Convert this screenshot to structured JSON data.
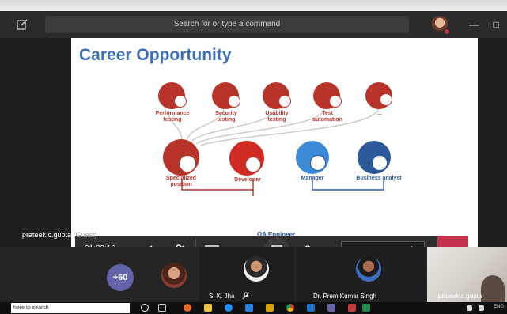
{
  "titlebar": {
    "search_placeholder": "Search for or type a command",
    "window_controls": [
      "—",
      "□"
    ]
  },
  "slide": {
    "title": "Career Opportunity",
    "top_nodes": [
      {
        "label": "Performance\ntesting",
        "icon": "stopwatch-icon"
      },
      {
        "label": "Security\ntesting",
        "icon": "lock-icon"
      },
      {
        "label": "Usability\ntesting",
        "icon": "thumbs-up-icon"
      },
      {
        "label": "Test\nautomation",
        "icon": "gear-icon"
      },
      {
        "label": "...",
        "icon": "magnifier-icon"
      }
    ],
    "bottom_nodes": [
      {
        "label": "Specialized\nposition",
        "icon": "cog-icon",
        "color": "#b8332a"
      },
      {
        "label": "Developer",
        "icon": "laptop-icon",
        "color": "#b8332a"
      },
      {
        "label": "Manager",
        "icon": "briefcase-icon",
        "color": "#2d5a9a"
      },
      {
        "label": "Business analyst",
        "icon": "document-icon",
        "color": "#2d5a9a"
      }
    ],
    "qa_label": "QA Engineer"
  },
  "presenter": {
    "name": "prateek.c.gupta",
    "suffix": " (Guest)"
  },
  "controls": {
    "timer": "01:22:16",
    "request_control": "Request control",
    "icons": [
      "camera-off-icon",
      "mic-off-icon",
      "share-screen-icon",
      "more-icon",
      "chat-icon",
      "participants-icon",
      "hang-up-icon"
    ]
  },
  "participants": {
    "overflow_count": "+60",
    "tiles": [
      {
        "name": ""
      },
      {
        "name": "S. K. Jha"
      },
      {
        "name": "Dr. Prem Kumar Singh"
      },
      {
        "name": "prateek.c.gupta"
      }
    ]
  },
  "taskbar": {
    "search_text": "here to search",
    "lang": "ENG"
  },
  "colors": {
    "teams_purple": "#6264a7",
    "hangup_red": "#c4314b",
    "slide_red": "#b8332a",
    "slide_blue": "#2d5a9a",
    "title_blue": "#3a6fb6"
  }
}
